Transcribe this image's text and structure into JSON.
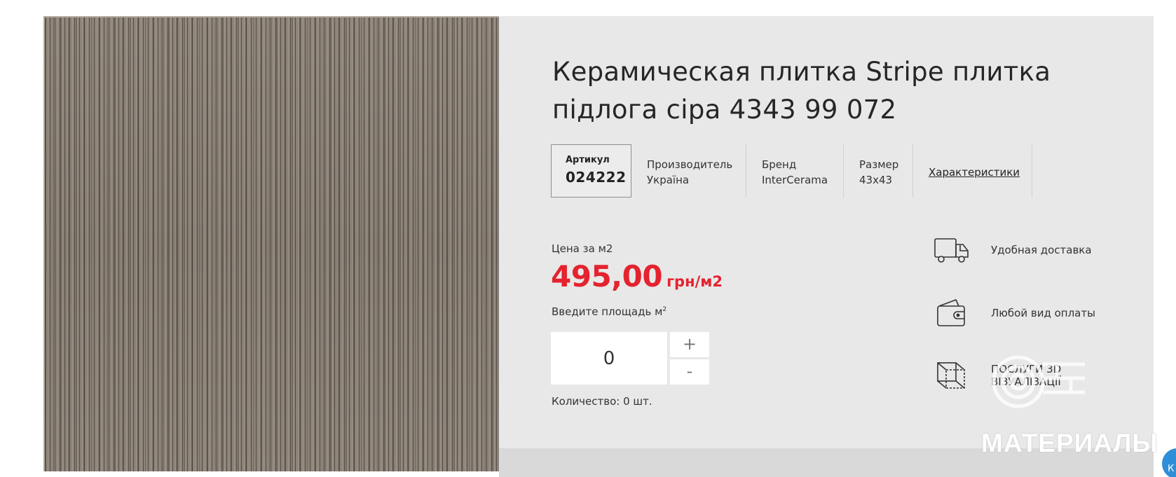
{
  "product": {
    "title_line1": "Керамическая плитка Stripe плитка",
    "title_line2": "підлога сіра 4343 99 072"
  },
  "attributes": {
    "article_label": "Артикул",
    "article_value": "024222",
    "manufacturer_label": "Производитель",
    "manufacturer_value": "Україна",
    "brand_label": "Бренд",
    "brand_value": "InterCerama",
    "size_label": "Размер",
    "size_value": "43x43",
    "characteristics_link": "Характеристики"
  },
  "pricing": {
    "price_label": "Цена за м2",
    "price_amount": "495,00",
    "price_unit": "грн/м2",
    "price_color": "#e4232f",
    "area_label": "Введите площадь м",
    "area_label_sup": "2",
    "quantity_value": "0",
    "plus_label": "+",
    "minus_label": "-",
    "quantity_note": "Количество: 0 шт."
  },
  "features": [
    {
      "icon": "delivery-truck-icon",
      "label": "Удобная доставка"
    },
    {
      "icon": "wallet-icon",
      "label": "Любой вид оплаты"
    },
    {
      "icon": "3d-cube-icon",
      "label_line1": "ПОСЛУГИ 3D",
      "label_line2": "ВІЗУАЛІЗАЦІЇ"
    }
  ],
  "watermark": {
    "text": "МАТЕРИАЛЫ"
  },
  "corner_badge": {
    "text": "К"
  }
}
